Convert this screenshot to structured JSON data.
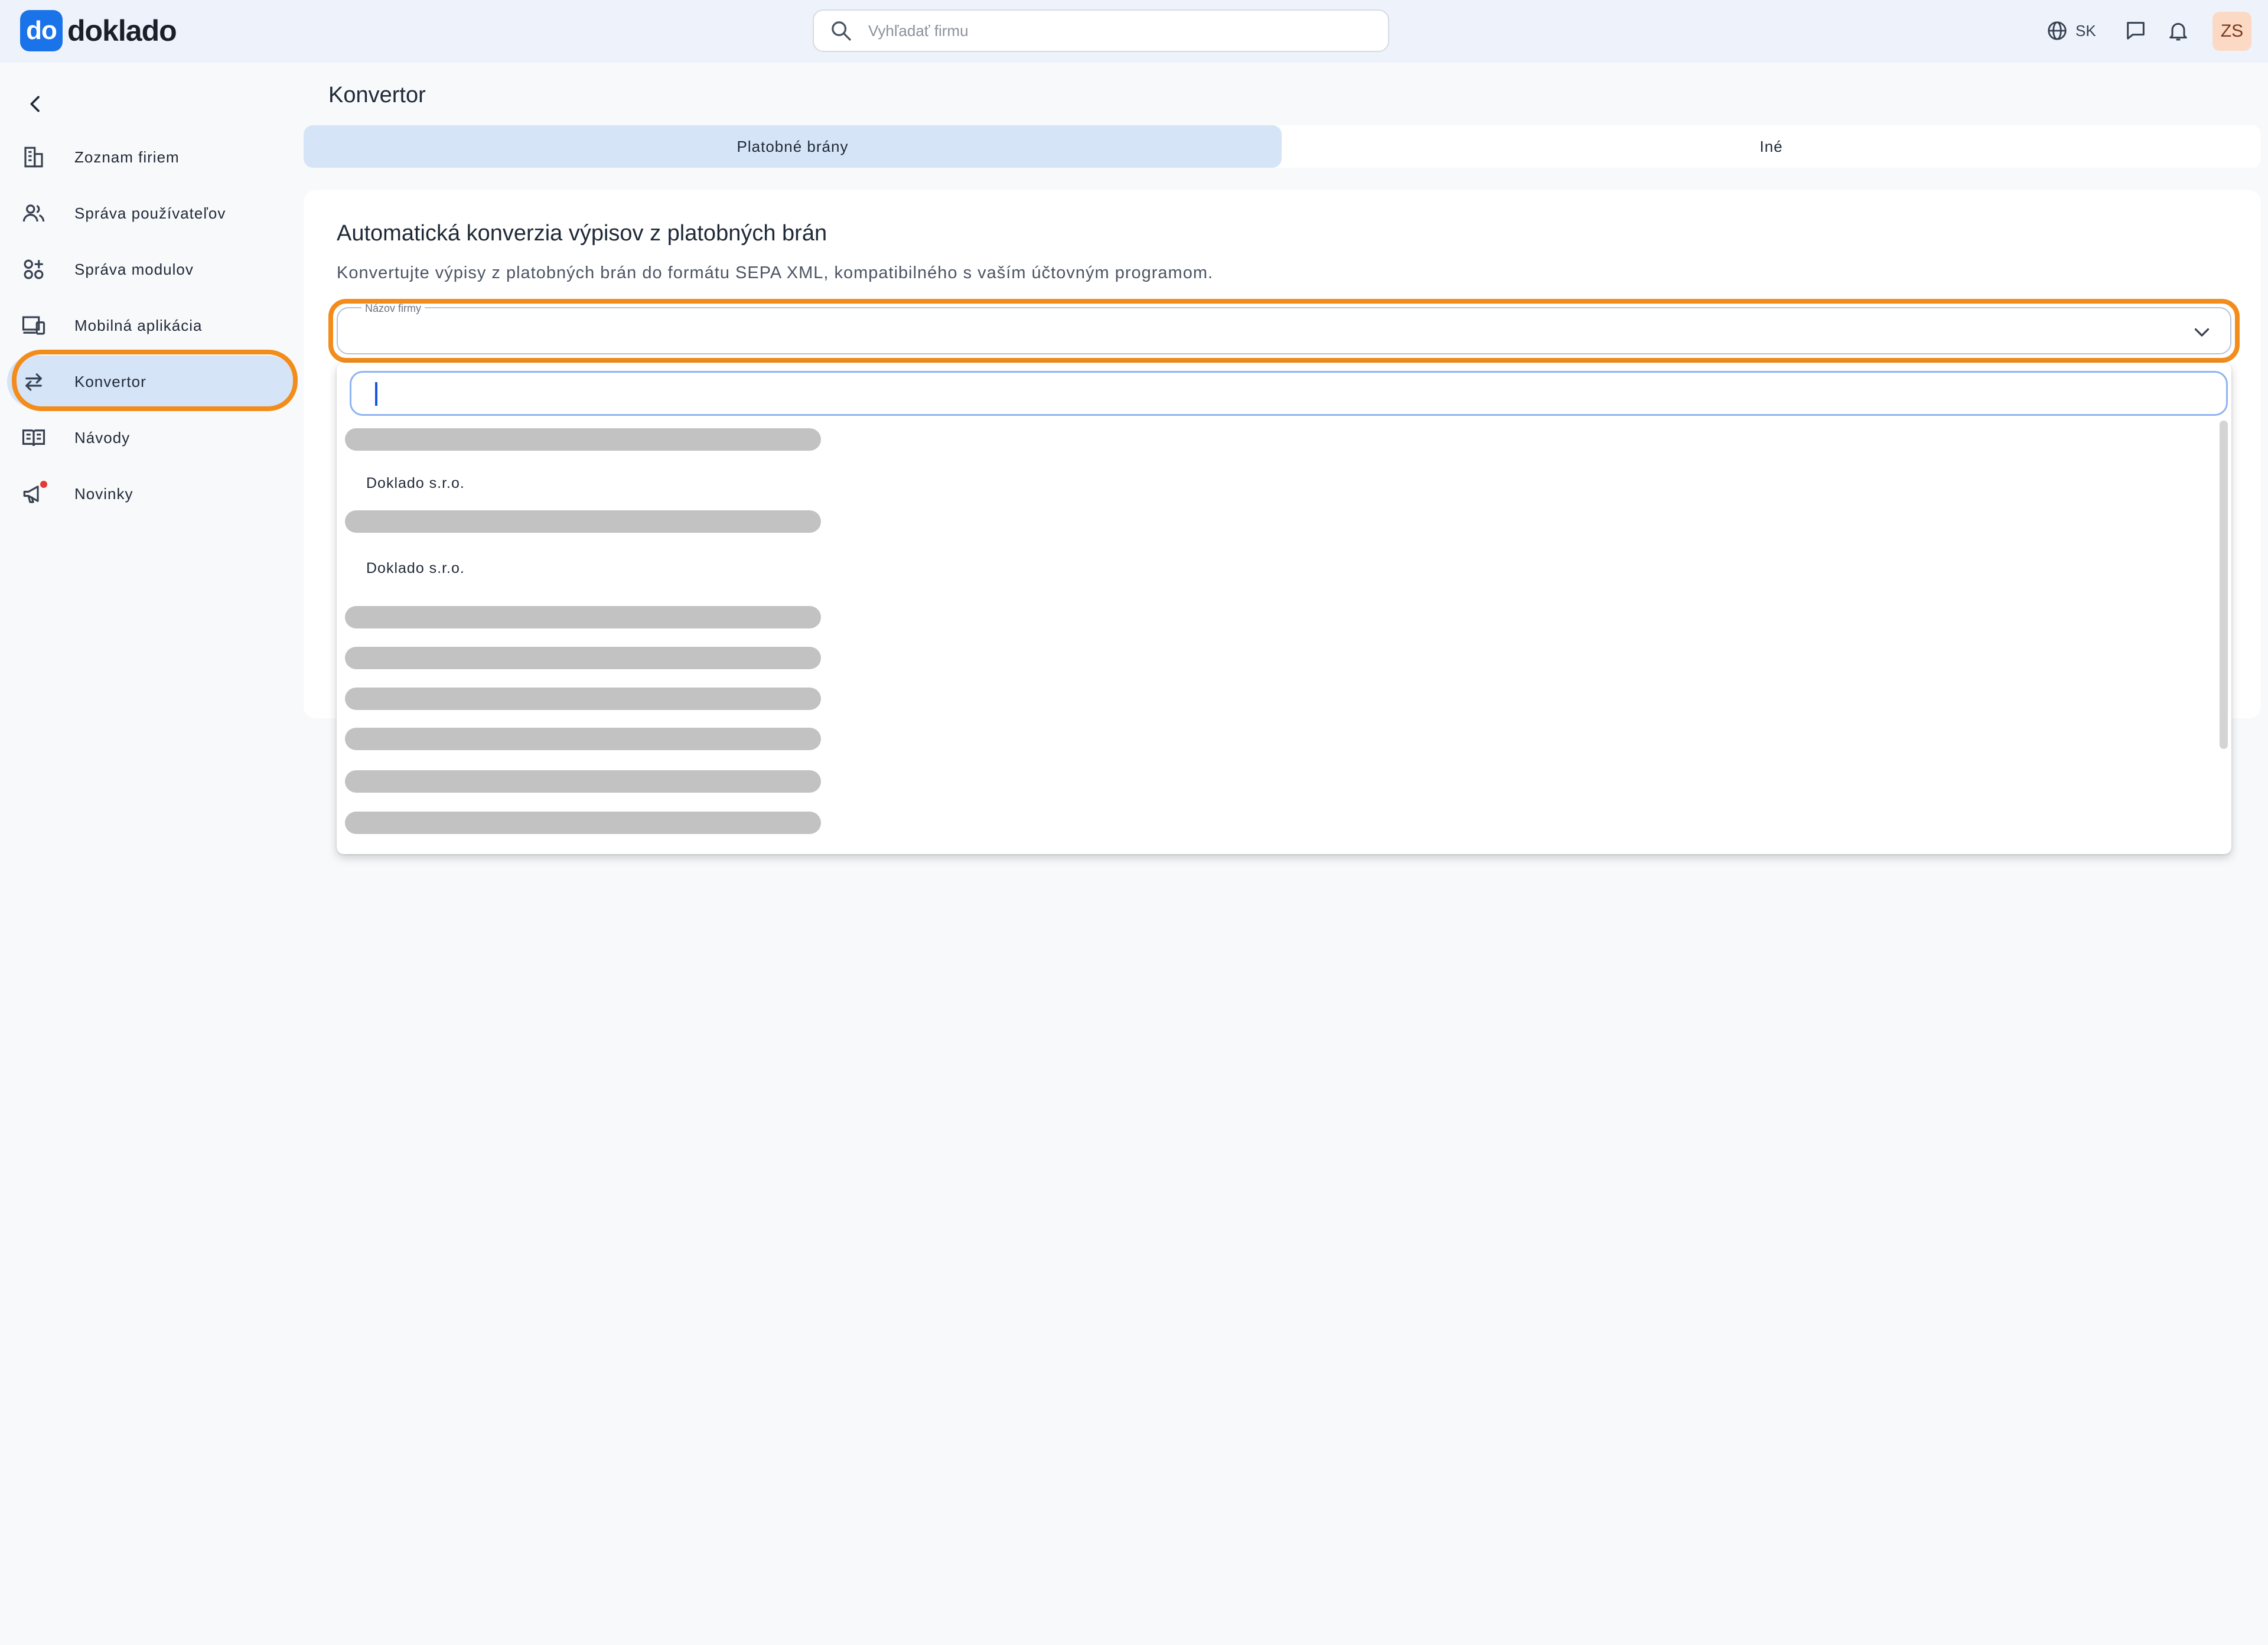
{
  "app": {
    "logo_badge": "do",
    "logo_text": "doklado"
  },
  "header": {
    "search_placeholder": "Vyhľadať firmu",
    "language": "SK",
    "avatar_initials": "ZS"
  },
  "sidebar": {
    "items": [
      {
        "label": "Zoznam firiem",
        "icon": "building-icon"
      },
      {
        "label": "Správa používateľov",
        "icon": "users-icon"
      },
      {
        "label": "Správa modulov",
        "icon": "modules-icon"
      },
      {
        "label": "Mobilná aplikácia",
        "icon": "devices-icon"
      },
      {
        "label": "Konvertor",
        "icon": "convert-arrows-icon",
        "active": true
      },
      {
        "label": "Návody",
        "icon": "book-icon"
      },
      {
        "label": "Novinky",
        "icon": "megaphone-icon"
      }
    ]
  },
  "main": {
    "page_title": "Konvertor",
    "tabs": [
      {
        "label": "Platobné brány",
        "active": true
      },
      {
        "label": "Iné",
        "active": false
      }
    ],
    "card": {
      "title": "Automatická konverzia výpisov z platobných brán",
      "description": "Konvertujte výpisy z platobných brán do formátu SEPA XML, kompatibilného s vaším účtovným programom.",
      "select_label": "Názov firmy",
      "select_value": ""
    },
    "dropdown": {
      "search_value": "",
      "items": [
        "Doklado s.r.o.",
        "Doklado s.r.o."
      ]
    }
  },
  "colors": {
    "accent": "#1a73e8",
    "highlight": "#f28c1b",
    "active_bg": "#d6e4f8"
  }
}
